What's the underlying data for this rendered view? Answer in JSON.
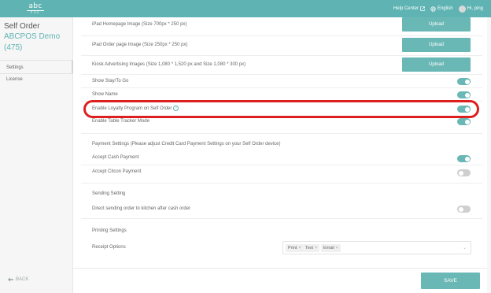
{
  "header": {
    "logo_top": "abc",
    "logo_bottom": "POS",
    "help_center": "Help Center",
    "language": "English",
    "greeting": "Hi, ping"
  },
  "sidebar": {
    "title": "Self Order",
    "store": "ABCPOS Demo (475)",
    "items": [
      {
        "label": "Settings"
      },
      {
        "label": "License"
      }
    ],
    "back_label": "BACK"
  },
  "settings": {
    "ipad_homepage_image": "iPad Homepage Image (Size 700px * 250 px)",
    "ipad_order_page_image": "iPad Order page Image (Size 250px * 250 px)",
    "kiosk_advertising_images": "Kiosk Advertising Images (Size 1,080 * 1,520 px and Size 1,080 * 300 px)",
    "upload_label": "Upload",
    "show_stay_to_go": {
      "label": "Show Stay/To Go",
      "enabled": true
    },
    "show_name": {
      "label": "Show Name",
      "enabled": true
    },
    "enable_loyalty": {
      "label": "Enable Loyalty Program on Self Order",
      "enabled": true
    },
    "enable_table_tracker": {
      "label": "Enable Table Tracker Mode",
      "enabled": true
    },
    "payment_settings_heading": "Payment Settings (Please adjust Credit Card Payment Settings on your Self Order device)",
    "accept_cash": {
      "label": "Accept Cash Payment",
      "enabled": true
    },
    "accept_citcon": {
      "label": "Accept Citcon Payment",
      "enabled": false
    },
    "sending_setting_heading": "Sending Setting",
    "direct_sending": {
      "label": "Direct sending order to kitchen after cash order",
      "enabled": false
    },
    "printing_settings_heading": "Printing Settings",
    "receipt_options": {
      "label": "Receipt Options",
      "chips": [
        "Print",
        "Text",
        "Email"
      ]
    }
  },
  "footer": {
    "save_label": "SAVE"
  },
  "colors": {
    "accent": "#6ab8b5",
    "highlight": "#dd1f1f"
  }
}
